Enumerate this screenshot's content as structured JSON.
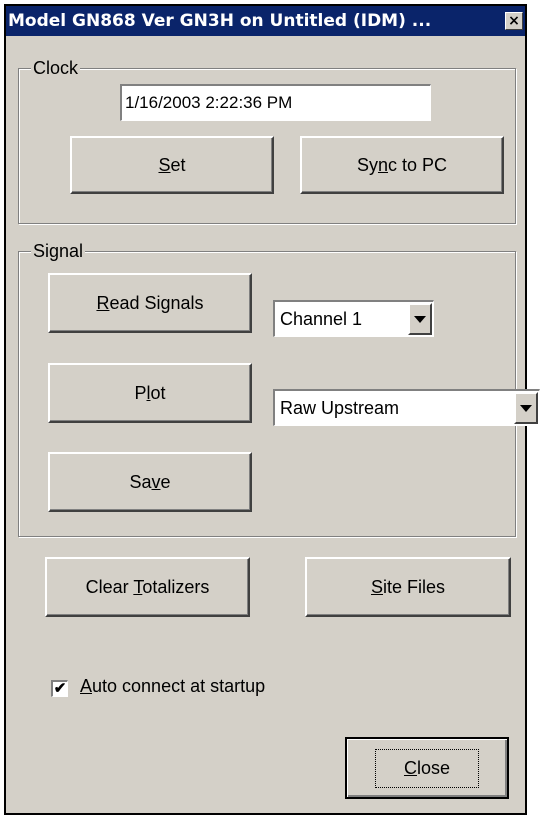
{
  "window": {
    "title": "Model GN868 Ver GN3H on Untitled (IDM) ...",
    "close_glyph": "×"
  },
  "clock": {
    "group_label": "Clock",
    "datetime_value": "1/16/2003 2:22:36 PM",
    "set_button": {
      "pre": "",
      "u": "S",
      "post": "et"
    },
    "sync_button": {
      "pre": "Sy",
      "u": "n",
      "post": "c to PC"
    }
  },
  "signal": {
    "group_label": "Signal",
    "read_button": {
      "pre": "",
      "u": "R",
      "post": "ead Signals"
    },
    "plot_button": {
      "pre": "P",
      "u": "l",
      "post": "ot"
    },
    "save_button": {
      "pre": "Sa",
      "u": "v",
      "post": "e"
    },
    "channel_select": "Channel 1",
    "plot_type_select": "Raw Upstream"
  },
  "actions": {
    "clear_button": {
      "pre": "Clear ",
      "u": "T",
      "post": "otalizers"
    },
    "site_button": {
      "pre": "",
      "u": "S",
      "post": "ite Files"
    },
    "auto_connect": {
      "checked": true,
      "pre": "",
      "u": "A",
      "post": "uto connect at startup"
    },
    "close_button": {
      "pre": "",
      "u": "C",
      "post": "lose"
    }
  },
  "icons": {
    "dropdown": "chevron-down-icon",
    "checkmark": "checkmark-icon"
  }
}
